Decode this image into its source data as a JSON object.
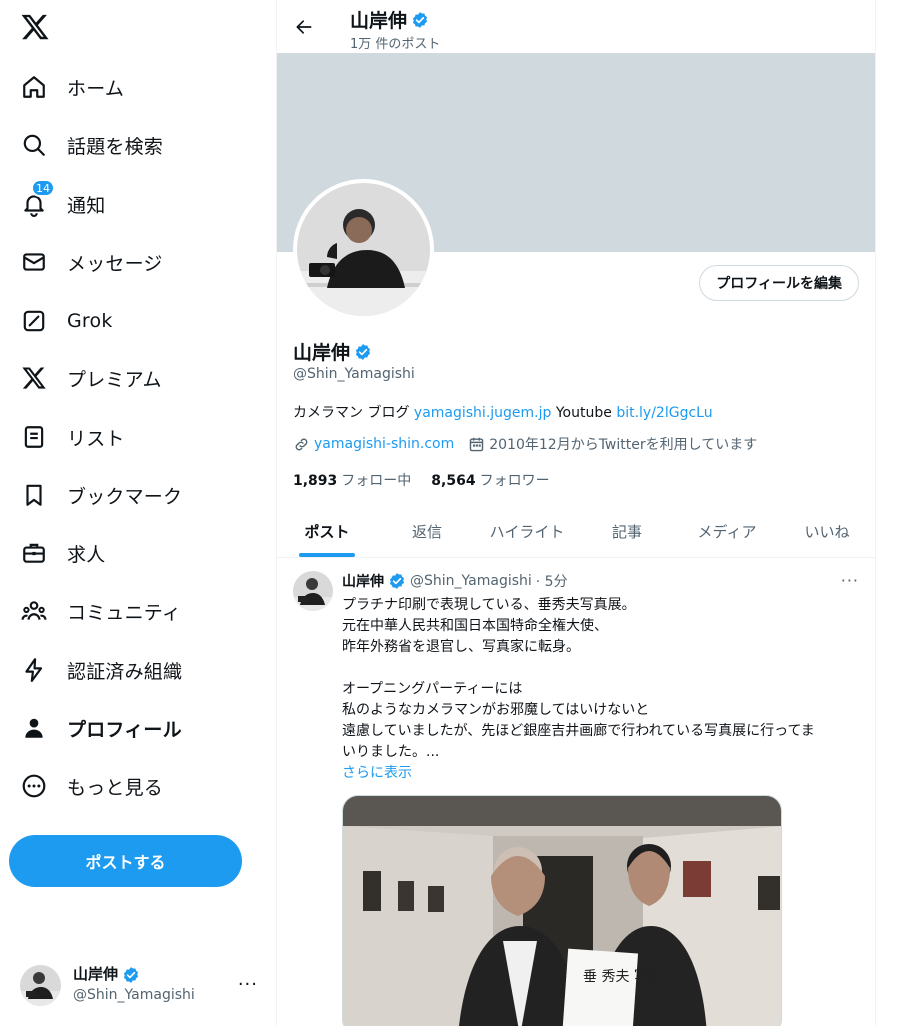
{
  "nav": {
    "items": [
      {
        "label": "ホーム",
        "icon": "home-icon"
      },
      {
        "label": "話題を検索",
        "icon": "search-icon"
      },
      {
        "label": "通知",
        "icon": "bell-icon",
        "badge": "14"
      },
      {
        "label": "メッセージ",
        "icon": "envelope-icon"
      },
      {
        "label": "Grok",
        "icon": "grok-icon"
      },
      {
        "label": "プレミアム",
        "icon": "x-logo-icon"
      },
      {
        "label": "リスト",
        "icon": "list-icon"
      },
      {
        "label": "ブックマーク",
        "icon": "bookmark-icon"
      },
      {
        "label": "求人",
        "icon": "briefcase-icon"
      },
      {
        "label": "コミュニティ",
        "icon": "people-icon"
      },
      {
        "label": "認証済み組織",
        "icon": "lightning-icon"
      },
      {
        "label": "プロフィール",
        "icon": "person-icon"
      },
      {
        "label": "もっと見る",
        "icon": "more-circle-icon"
      }
    ],
    "post_button": "ポストする"
  },
  "account": {
    "name": "山岸伸",
    "handle": "@Shin_Yamagishi",
    "more": "···"
  },
  "header": {
    "name": "山岸伸",
    "post_count": "1万 件のポスト"
  },
  "profile": {
    "edit_button": "プロフィールを編集",
    "name": "山岸伸",
    "handle": "@Shin_Yamagishi",
    "bio_prefix": "カメラマン ブログ ",
    "bio_link1": "yamagishi.jugem.jp",
    "bio_mid": " Youtube ",
    "bio_link2": "bit.ly/2lGgcLu",
    "website": "yamagishi-shin.com",
    "joined": "2010年12月からTwitterを利用しています",
    "following_count": "1,893",
    "following_label": "フォロー中",
    "followers_count": "8,564",
    "followers_label": "フォロワー"
  },
  "tabs": [
    "ポスト",
    "返信",
    "ハイライト",
    "記事",
    "メディア",
    "いいね"
  ],
  "tweet": {
    "name": "山岸伸",
    "handle": "@Shin_Yamagishi",
    "time": "· 5分",
    "more": "···",
    "lines": [
      "プラチナ印刷で表現している、垂秀夫写真展。",
      "元在中華人民共和国日本国特命全権大使、",
      "昨年外務省を退官し、写真家に転身。",
      "",
      "オープニングパーティーには",
      "私のようなカメラマンがお邪魔してはいけないと",
      "遠慮していましたが、先ほど銀座吉井画廊で行われている写真展に行ってま",
      "いりました。..."
    ],
    "show_more": "さらに表示",
    "media_book_text": "垂 秀夫 写真"
  },
  "colors": {
    "accent": "#1d9bf0",
    "banner": "#cfd9de",
    "text": "#0f1419",
    "muted": "#536471"
  }
}
